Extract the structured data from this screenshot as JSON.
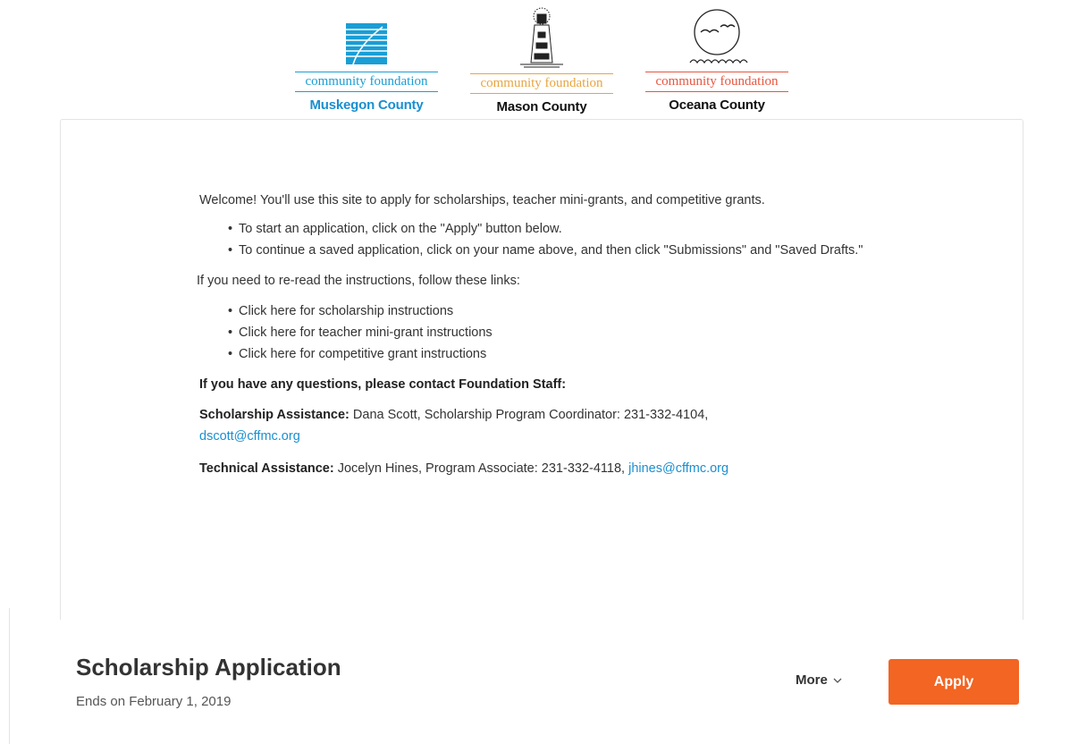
{
  "logos": [
    {
      "line": "community foundation",
      "county": "Muskegon County",
      "color": "#1a9ed5",
      "icon": "waves-logo-icon"
    },
    {
      "line": "community foundation",
      "county": "Mason County",
      "color": "#e8a541",
      "icon": "lighthouse-logo-icon"
    },
    {
      "line": "community foundation",
      "county": "Oceana County",
      "color": "#e8553f",
      "icon": "gulls-sun-logo-icon"
    }
  ],
  "intro": {
    "welcome": "Welcome!  You'll use this site to apply for scholarships, teacher mini-grants, and competitive grants.",
    "steps": [
      "To start an application, click on the \"Apply\" button below.",
      "To continue a saved application, click on your name above, and then click \"Submissions\" and \"Saved Drafts.\""
    ],
    "reread": "If you need to re-read the instructions, follow these links:",
    "links": [
      "Click here for scholarship instructions",
      "Click here for teacher mini-grant instructions",
      "Click here for competitive grant instructions"
    ],
    "questions": "If you have any questions, please contact Foundation Staff:",
    "scholarship": {
      "label": "Scholarship Assistance:",
      "text": " Dana Scott, Scholarship Program Coordinator: 231-332-4104, ",
      "email": "dscott@cffmc.org"
    },
    "technical": {
      "label": "Technical Assistance:",
      "text": " Jocelyn Hines, Program Associate: 231-332-4118, ",
      "email": "jhines@cffmc.org"
    }
  },
  "application": {
    "title": "Scholarship Application",
    "ends": "Ends on February 1, 2019",
    "more_label": "More",
    "apply_label": "Apply",
    "accent": "#f26522"
  }
}
